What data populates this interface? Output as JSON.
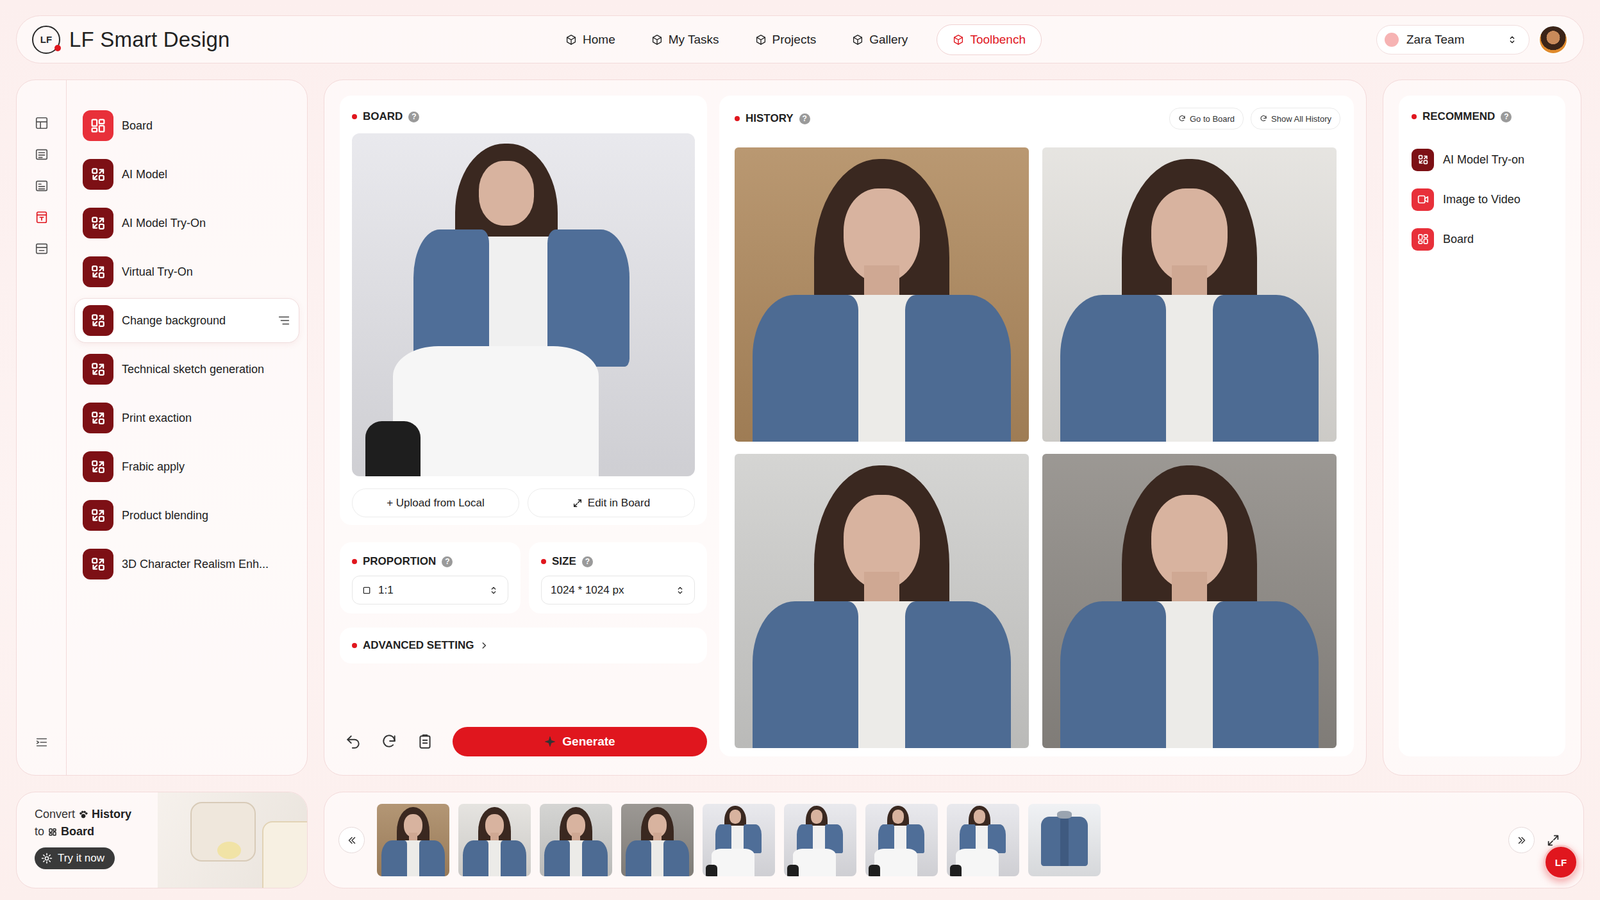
{
  "app": {
    "logo": "LF",
    "brand": "LF Smart Design"
  },
  "help": "?",
  "nav": [
    {
      "label": "Home",
      "selected": false
    },
    {
      "label": "My Tasks",
      "selected": false
    },
    {
      "label": "Projects",
      "selected": false
    },
    {
      "label": "Gallery",
      "selected": false
    },
    {
      "label": "Toolbench",
      "selected": true
    }
  ],
  "team": {
    "name": "Zara Team"
  },
  "rail": [
    {
      "selected": false
    },
    {
      "selected": false
    },
    {
      "selected": false
    },
    {
      "selected": true
    },
    {
      "selected": false
    }
  ],
  "tools": [
    {
      "label": "Board",
      "kind": "board",
      "selected": false
    },
    {
      "label": "AI Model",
      "kind": "tool",
      "selected": false
    },
    {
      "label": "AI Model Try-On",
      "kind": "tool",
      "selected": false
    },
    {
      "label": "Virtual Try-On",
      "kind": "tool",
      "selected": false
    },
    {
      "label": "Change background",
      "kind": "tool",
      "selected": true
    },
    {
      "label": "Technical sketch generation",
      "kind": "tool",
      "selected": false
    },
    {
      "label": "Print exaction",
      "kind": "tool",
      "selected": false
    },
    {
      "label": "Frabic apply",
      "kind": "tool",
      "selected": false
    },
    {
      "label": "Product blending",
      "kind": "tool",
      "selected": false
    },
    {
      "label": "3D Character Realism Enh...",
      "kind": "tool",
      "selected": false
    }
  ],
  "board": {
    "title": "BOARD",
    "upload": "+ Upload from Local",
    "edit": "Edit in Board",
    "image": {
      "kind": "seated",
      "color": "#e6e6eb"
    }
  },
  "proportion": {
    "label": "PROPORTION",
    "value": "1:1"
  },
  "size": {
    "label": "SIZE",
    "value": "1024 * 1024 px"
  },
  "advanced": {
    "label": "ADVANCED SETTING",
    "expanded": false
  },
  "generate": "Generate",
  "history": {
    "title": "HISTORY",
    "buttons": [
      "Go to Board",
      "Show All History"
    ],
    "images": [
      {
        "kind": "closeup",
        "color": "#b08a5e"
      },
      {
        "kind": "closeup",
        "color": "#e3e1dd"
      },
      {
        "kind": "closeup",
        "color": "#cfcfcd"
      },
      {
        "kind": "closeup",
        "color": "#8e8a85"
      }
    ]
  },
  "recommend": {
    "title": "RECOMMEND",
    "items": [
      {
        "label": "AI Model Try-on",
        "kind": "tool"
      },
      {
        "label": "Image to Video",
        "kind": "video"
      },
      {
        "label": "Board",
        "kind": "board"
      }
    ]
  },
  "promo": {
    "convert": "Convert",
    "history": "History",
    "to": "to",
    "board": "Board",
    "button": "Try it now"
  },
  "filmstrip": [
    {
      "kind": "closeup",
      "color": "#a98862"
    },
    {
      "kind": "closeup",
      "color": "#e2e0dc"
    },
    {
      "kind": "closeup",
      "color": "#cfcfcd"
    },
    {
      "kind": "closeup",
      "color": "#8e8a85"
    },
    {
      "kind": "seated",
      "color": "#e6e6eb"
    },
    {
      "kind": "seated",
      "color": "#e6e6eb"
    },
    {
      "kind": "seated",
      "color": "#e6e6eb"
    },
    {
      "kind": "seated",
      "color": "#e6e6eb"
    },
    {
      "kind": "garment",
      "color": "#eef0f3"
    }
  ]
}
